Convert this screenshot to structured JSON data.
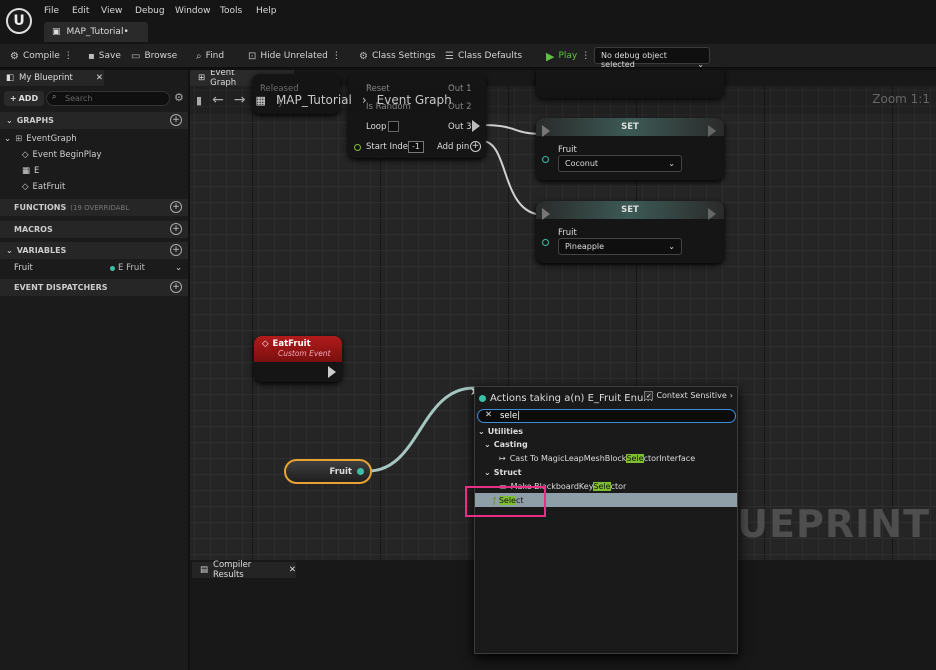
{
  "app": {
    "logo": "U",
    "menu": [
      "File",
      "Edit",
      "View",
      "Debug",
      "Window",
      "Tools",
      "Help"
    ],
    "doc_tab": "MAP_Tutorial•"
  },
  "toolbar": {
    "compile": "Compile",
    "save": "Save",
    "browse": "Browse",
    "find": "Find",
    "hide_unrelated": "Hide Unrelated",
    "class_settings": "Class Settings",
    "class_defaults": "Class Defaults",
    "play": "Play",
    "debug_object": "No debug object selected"
  },
  "left_panel": {
    "tab": "My Blueprint",
    "add": "ADD",
    "search_placeholder": "Search",
    "graphs_header": "GRAPHS",
    "event_graph": "EventGraph",
    "graph_items": [
      "Event BeginPlay",
      "E",
      "EatFruit"
    ],
    "functions_header": "FUNCTIONS",
    "functions_note": "(19 OVERRIDABL",
    "macros_header": "MACROS",
    "variables_header": "VARIABLES",
    "variable": {
      "name": "Fruit",
      "type": "E Fruit"
    },
    "dispatchers_header": "EVENT DISPATCHERS"
  },
  "graph": {
    "tab": "Event Graph",
    "breadcrumb_root": "MAP_Tutorial",
    "breadcrumb_leaf": "Event Graph",
    "zoom": "Zoom 1:1",
    "watermark": "BLUEPRINT",
    "random_node": {
      "reset": "Reset",
      "is_random": "Is Random",
      "loop": "Loop",
      "start_index": "Start Index",
      "start_index_value": "-1",
      "out1": "Out 1",
      "out2": "Out 2",
      "out3": "Out 3",
      "add_pin": "Add pin",
      "released": "Released",
      "key": "y"
    },
    "set_nodes": [
      {
        "title": "SET",
        "pin": "Fruit",
        "value": "Coconut"
      },
      {
        "title": "SET",
        "pin": "Fruit",
        "value": "Pineapple"
      }
    ],
    "event_node": {
      "title": "EatFruit",
      "subtitle": "Custom Event"
    },
    "getter_node": {
      "label": "Fruit"
    }
  },
  "bottom": {
    "tab": "Compiler Results"
  },
  "action_menu": {
    "title": "Actions taking a(n) E_Fruit Enum",
    "context": "Context Sensitive",
    "query": "sele",
    "cat_utilities": "Utilities",
    "cat_casting": "Casting",
    "cast_pre": "Cast To MagicLeapMeshBlock",
    "cast_hl": "Sele",
    "cast_post": "ctorInterface",
    "cat_struct": "Struct",
    "make_pre": "Make BlackboardKey",
    "make_hl": "Sele",
    "make_post": "ctor",
    "select_hl": "Sele",
    "select_post": "ct"
  },
  "colors": {
    "accent_blue": "#3a8fd6",
    "annotation": "#e82f86",
    "event_red": "#a51616",
    "highlight": "#7fbf2f",
    "enum_pin": "#3dbfa6",
    "selection_orange": "#e6a233"
  }
}
